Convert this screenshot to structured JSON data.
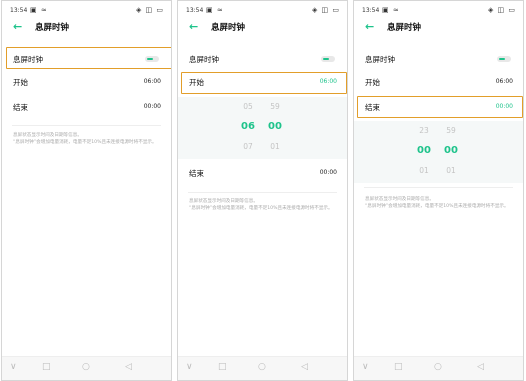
{
  "status": {
    "time": "13:54",
    "left_icons": "▣ ≈",
    "right_icons": "◈ ◫ ▭"
  },
  "title": "息屏时钟",
  "labels": {
    "toggle": "息屏时钟",
    "start": "开始",
    "end": "结束"
  },
  "values": {
    "start": "06:00",
    "end": "00:00"
  },
  "note": "息屏状态显示时间及日期等信息。\n“息屏时钟”会增加电量消耗，电量不足10%且未连接电源时将不显示。",
  "picker_start": {
    "hour": [
      "05",
      "06",
      "07"
    ],
    "minute": [
      "59",
      "00",
      "01"
    ]
  },
  "picker_end": {
    "hour": [
      "23",
      "00",
      "01"
    ],
    "minute": [
      "59",
      "00",
      "01"
    ]
  },
  "nav": {
    "down": "∨",
    "recent": "□",
    "home": "○",
    "back": "◁"
  },
  "colors": {
    "accent": "#1ec38b",
    "highlight": "#e29e2a"
  }
}
